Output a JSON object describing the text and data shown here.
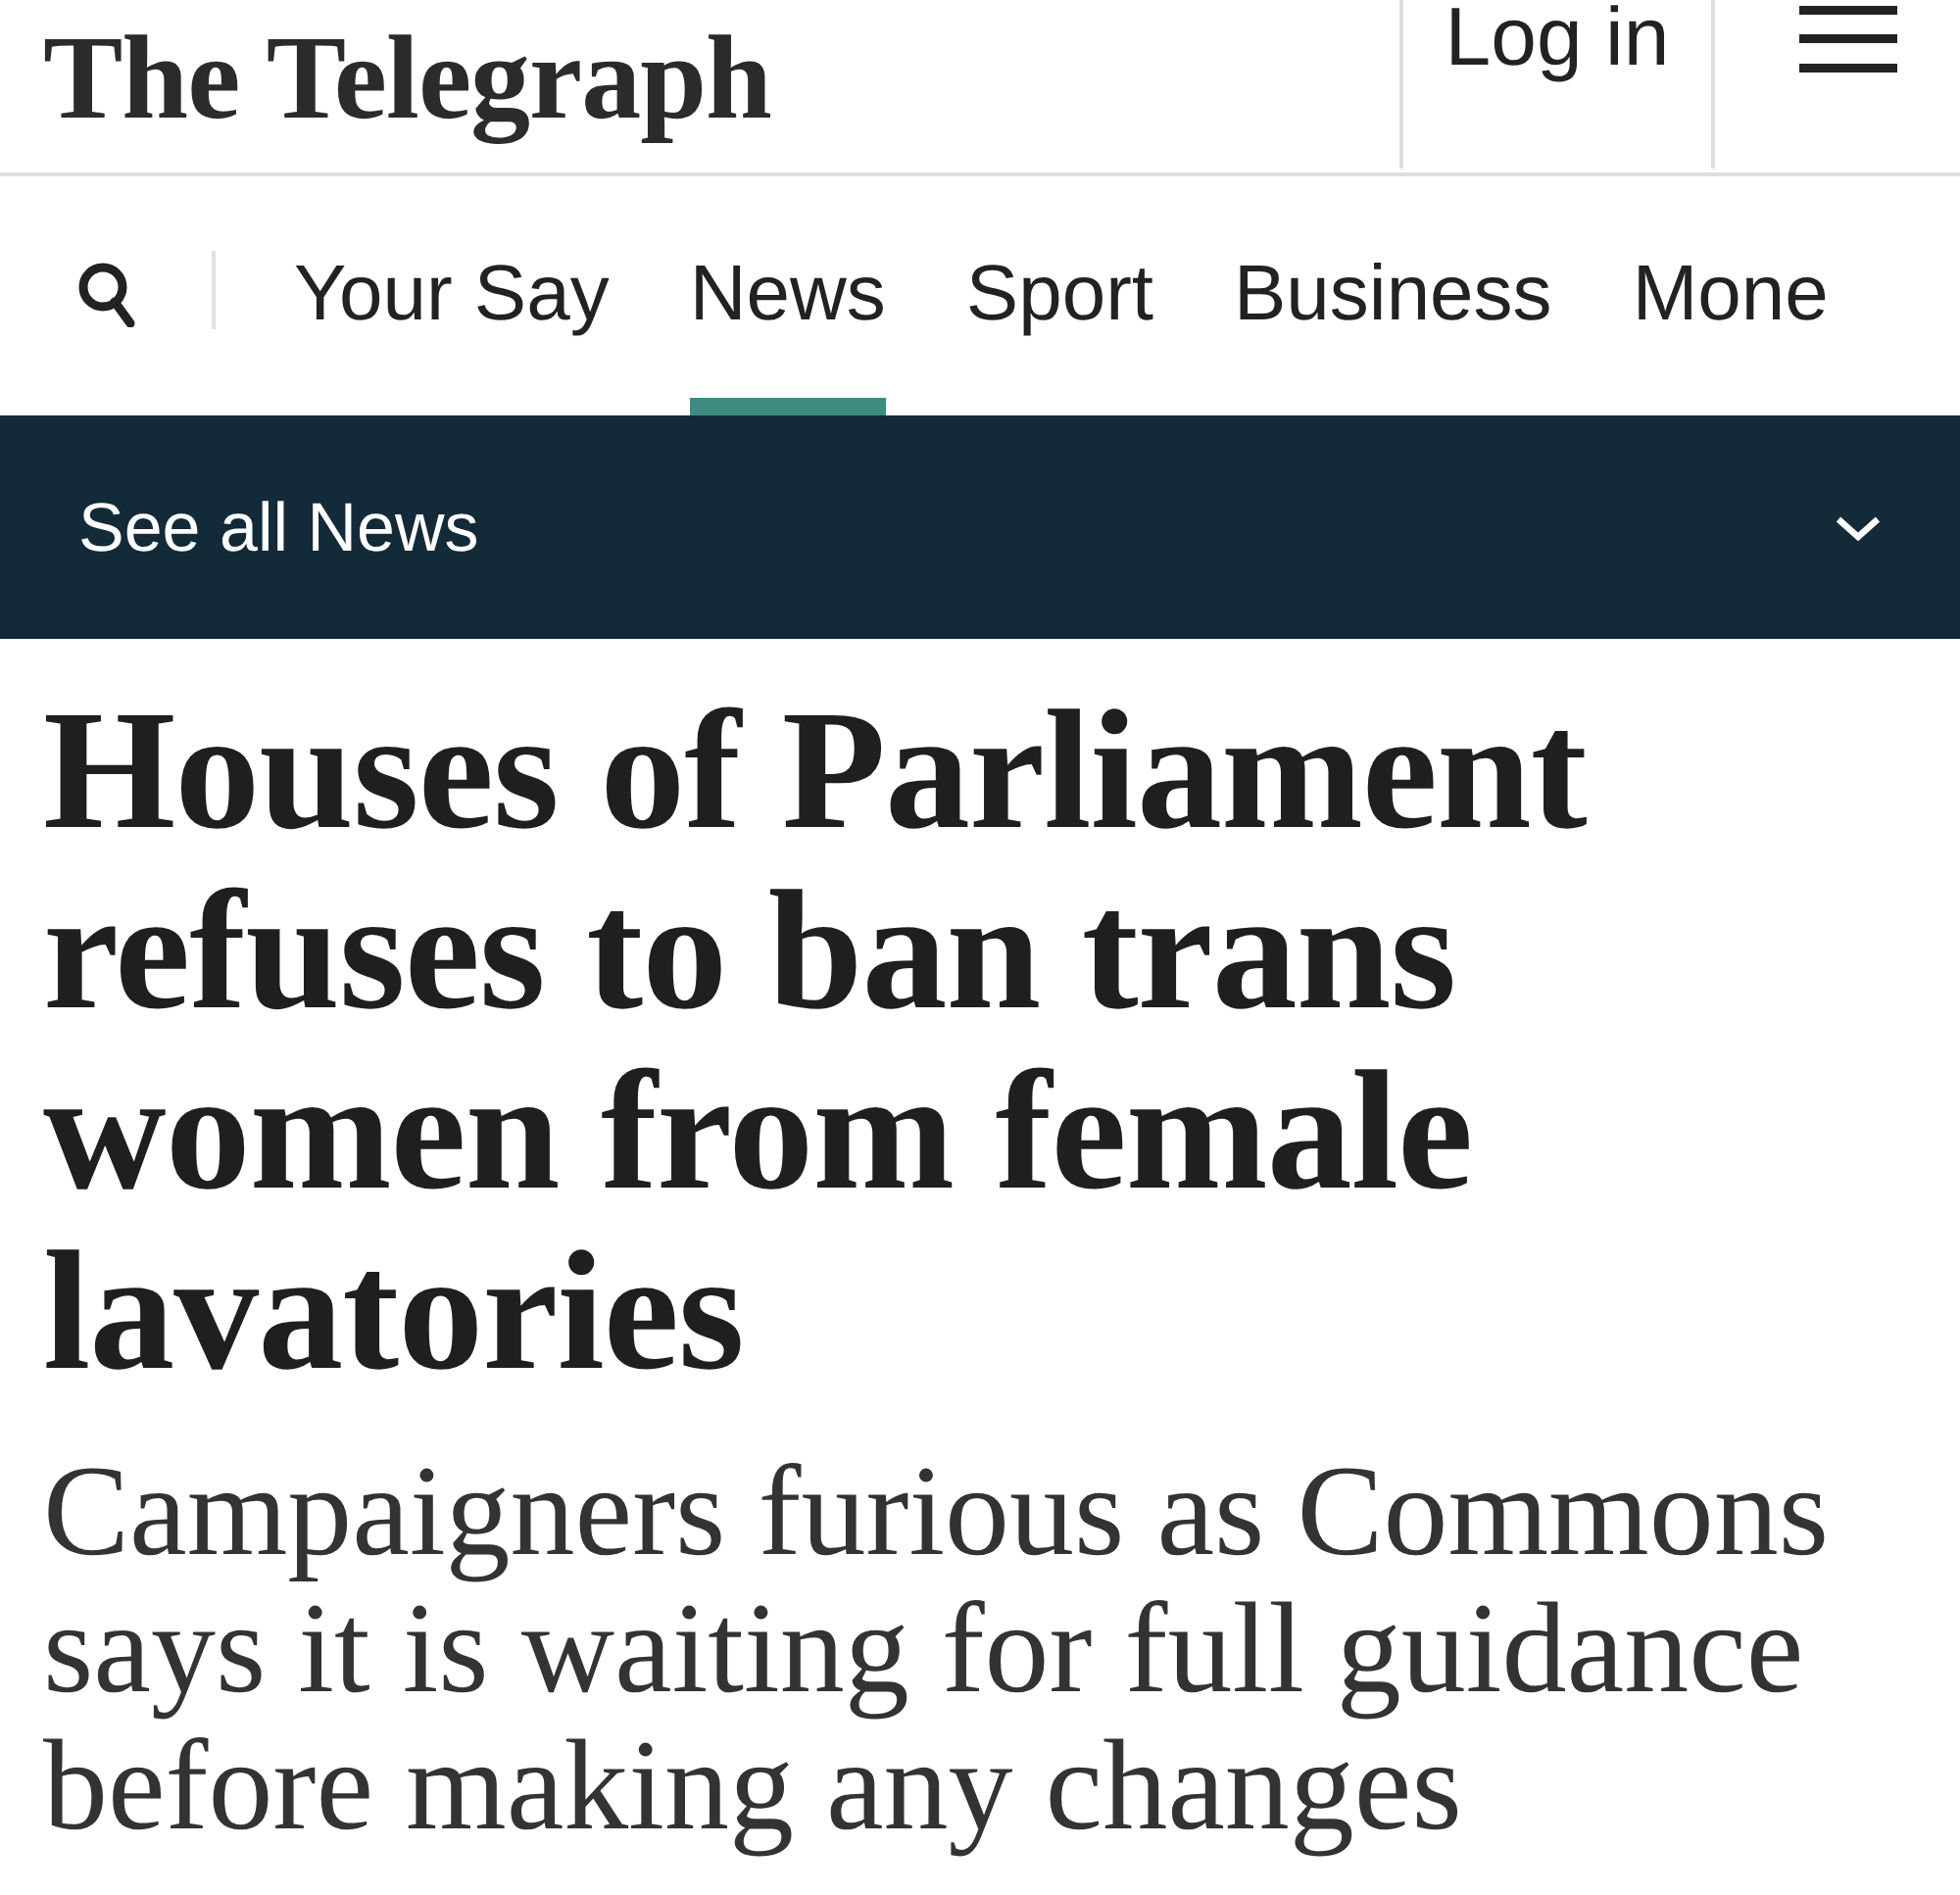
{
  "header": {
    "logo": "The Telegraph",
    "login": "Log in"
  },
  "nav": {
    "items": [
      {
        "label": "Your Say",
        "selected": false
      },
      {
        "label": "News",
        "selected": true
      },
      {
        "label": "Sport",
        "selected": false
      },
      {
        "label": "Business",
        "selected": false
      },
      {
        "label": "Mone",
        "selected": false
      }
    ]
  },
  "section_bar": {
    "label": "See all News",
    "expanded": false
  },
  "article": {
    "headline": "Houses of Parliament refuses to ban trans women from female lavatories",
    "standfirst": "Campaigners furious as Commons says it is waiting for full guidance before making any changes"
  }
}
